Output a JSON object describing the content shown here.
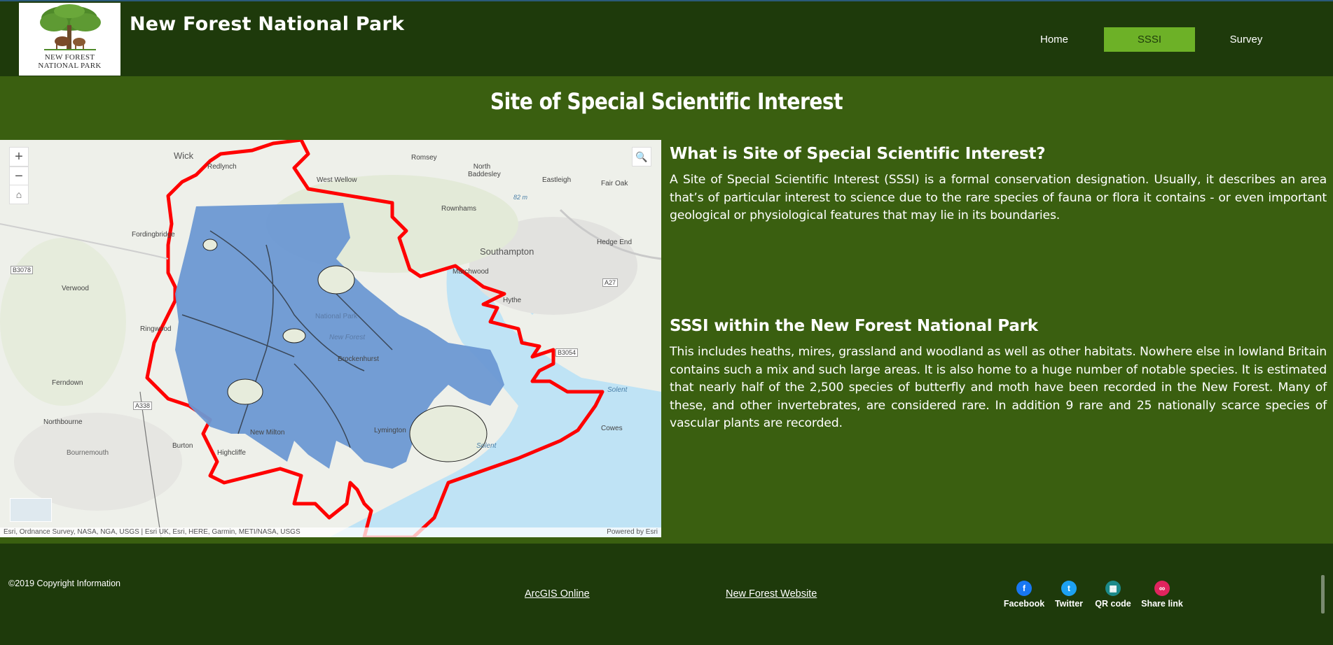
{
  "header": {
    "site_title": "New Forest National Park",
    "logo_line1": "NEW FOREST",
    "logo_line2": "NATIONAL PARK",
    "nav": [
      {
        "label": "Home",
        "active": false
      },
      {
        "label": "SSSI",
        "active": true
      },
      {
        "label": "Survey",
        "active": false
      }
    ]
  },
  "main": {
    "heading": "Site of Special Scientific Interest",
    "section1": {
      "title": "What is Site of Special Scientific Interest?",
      "body": "A Site of Special Scientific Interest (SSSI) is a formal conservation designation. Usually, it describes an area that’s of particular interest to science due to the rare species of fauna or flora it contains - or even important geological or physiological features that may lie in its boundaries."
    },
    "section2": {
      "title": "SSSI within the New Forest National Park",
      "body": "This includes heaths, mires, grassland and woodland as well as other habitats. Nowhere else in lowland Britain contains such a mix and such large areas. It is also home to a huge number of notable species. It is estimated that nearly half of the 2,500 species of butterfly and moth have been recorded in the New Forest. Many of these, and other invertebrates, are considered rare. In addition 9 rare and 25 nationally scarce species of vascular plants are recorded."
    }
  },
  "map": {
    "zoom_in": "+",
    "zoom_out": "−",
    "attribution": "Esri, Ordnance Survey, NASA, NGA, USGS | Esri UK, Esri, HERE, Garmin, METI/NASA, USGS",
    "powered_by": "Powered by Esri",
    "labels": {
      "wick": "Wick",
      "romsey": "Romsey",
      "north_baddesley": "North Baddesley",
      "redlynch": "Redlynch",
      "west_wellow": "West Wellow",
      "eastleigh": "Eastleigh",
      "fair_oak": "Fair Oak",
      "rownhams": "Rownhams",
      "fordingbridge": "Fordingbridge",
      "southampton": "Southampton",
      "hedge_end": "Hedge End",
      "b3078": "B3078",
      "marchwood": "Marchwood",
      "a27": "A27",
      "verwood": "Verwood",
      "hythe": "Hythe",
      "national_park": "National Park",
      "new_forest": "New Forest",
      "ringwood": "Ringwood",
      "brockenhurst": "Brockenhurst",
      "b3054": "B3054",
      "ferndown": "Ferndown",
      "solent1": "Solent",
      "a338": "A338",
      "northbourne": "Northbourne",
      "new_milton": "New Milton",
      "lymington": "Lymington",
      "cowes": "Cowes",
      "bournemouth": "Bournemouth",
      "burton": "Burton",
      "highcliffe": "Highcliffe",
      "solent2": "Solent",
      "m82": "82 m"
    }
  },
  "footer": {
    "copyright": "©2019 Copyright Information",
    "link1": "ArcGIS Online",
    "link2": "New Forest Website",
    "social": [
      {
        "label": "Facebook",
        "glyph": "f",
        "color": "#1877f2"
      },
      {
        "label": "Twitter",
        "glyph": "t",
        "color": "#1da1f2"
      },
      {
        "label": "QR code",
        "glyph": "▦",
        "color": "#1b8a8a"
      },
      {
        "label": "Share link",
        "glyph": "∞",
        "color": "#e0245e"
      }
    ]
  },
  "colors": {
    "header_bg": "#1e3a0b",
    "band_bg": "#3a5f10",
    "nav_active": "#6db127",
    "sssi_fill": "#6b98d3",
    "boundary": "#ff0000"
  }
}
